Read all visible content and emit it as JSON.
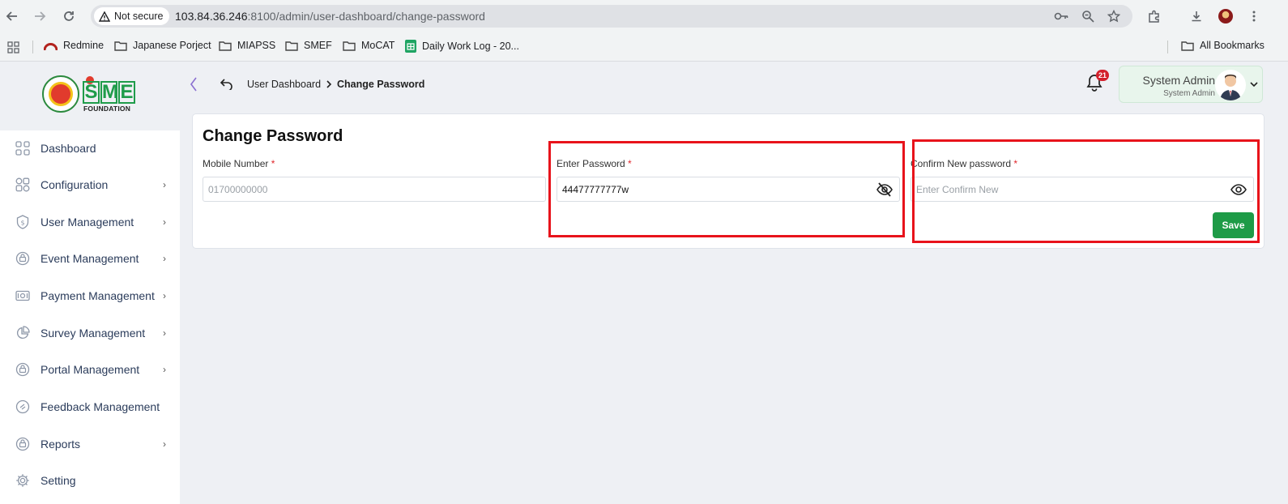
{
  "browser": {
    "security_label": "Not secure",
    "url_host": "103.84.36.246",
    "url_rest": ":8100/admin/user-dashboard/change-password",
    "bookmarks": [
      {
        "label": "Redmine",
        "icon": "redmine-icon"
      },
      {
        "label": "Japanese Porject",
        "icon": "folder-icon"
      },
      {
        "label": "MIAPSS",
        "icon": "folder-icon"
      },
      {
        "label": "SMEF",
        "icon": "folder-icon"
      },
      {
        "label": "MoCAT",
        "icon": "folder-icon"
      },
      {
        "label": "Daily Work Log - 20...",
        "icon": "sheets-icon"
      }
    ],
    "all_bookmarks_label": "All Bookmarks"
  },
  "logo": {
    "letters": [
      "S",
      "M",
      "E"
    ],
    "subtitle": "FOUNDATION"
  },
  "breadcrumb": {
    "parent": "User Dashboard",
    "current": "Change Password"
  },
  "notifications": {
    "count": "21"
  },
  "user": {
    "name": "System Admin",
    "role": "System Admin"
  },
  "sidebar": {
    "items": [
      {
        "label": "Dashboard",
        "icon": "grid-icon",
        "has_submenu": false
      },
      {
        "label": "Configuration",
        "icon": "config-icon",
        "has_submenu": true
      },
      {
        "label": "User Management",
        "icon": "user-shield-icon",
        "has_submenu": true
      },
      {
        "label": "Event Management",
        "icon": "event-icon",
        "has_submenu": true
      },
      {
        "label": "Payment Management",
        "icon": "payment-icon",
        "has_submenu": true
      },
      {
        "label": "Survey Management",
        "icon": "pie-chart-icon",
        "has_submenu": true
      },
      {
        "label": "Portal Management",
        "icon": "portal-icon",
        "has_submenu": true
      },
      {
        "label": "Feedback Management",
        "icon": "feedback-icon",
        "has_submenu": false
      },
      {
        "label": "Reports",
        "icon": "reports-icon",
        "has_submenu": true
      },
      {
        "label": "Setting",
        "icon": "gear-icon",
        "has_submenu": false
      }
    ]
  },
  "form": {
    "title": "Change Password",
    "mobile": {
      "label": "Mobile Number",
      "required_mark": "*",
      "placeholder": "01700000000",
      "value": ""
    },
    "password": {
      "label": "Enter Password",
      "required_mark": "*",
      "placeholder": "",
      "value": "44477777777w"
    },
    "confirm": {
      "label": "Confirm New password",
      "required_mark": "*",
      "placeholder": "Enter Confirm New",
      "value": ""
    },
    "save_label": "Save"
  },
  "colors": {
    "brand_green": "#1e9b47",
    "required_red": "#e0262b",
    "highlight_red": "#e8131b",
    "sidebar_text": "#2b3c5b"
  }
}
